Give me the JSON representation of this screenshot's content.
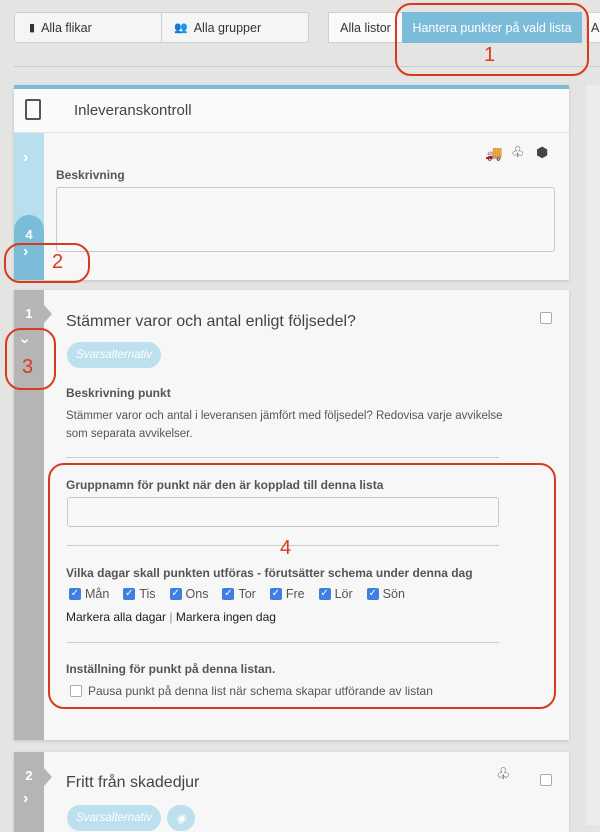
{
  "toolbar": {
    "all_tabs": "Alla flikar",
    "all_groups": "Alla grupper"
  },
  "tabs": [
    {
      "label": "Alla listor"
    },
    {
      "label": "Hantera punkter på vald lista",
      "active": true
    },
    {
      "label": "A"
    }
  ],
  "list_card": {
    "title": "Inleveranskontroll",
    "description_label": "Beskrivning",
    "description_value": "",
    "count": "4",
    "icons": [
      "truck-icon",
      "tree-icon",
      "cubes-icon"
    ]
  },
  "point1": {
    "number": "1",
    "title": "Stämmer varor och antal enligt följsedel?",
    "answer_btn": "Svarsalternativ",
    "desc_label": "Beskrivning punkt",
    "desc_text": "Stämmer varor och antal i leveransen jämfört med följsedel? Redovisa varje avvikelse som separata avvikelser.",
    "group_label": "Gruppnamn för punkt när den är kopplad till denna lista",
    "group_value": "",
    "days_label": "Vilka dagar skall punkten utföras - förutsätter schema under denna dag",
    "days": [
      {
        "label": "Mån",
        "checked": true
      },
      {
        "label": "Tis",
        "checked": true
      },
      {
        "label": "Ons",
        "checked": true
      },
      {
        "label": "Tor",
        "checked": true
      },
      {
        "label": "Fre",
        "checked": true
      },
      {
        "label": "Lör",
        "checked": true
      },
      {
        "label": "Sön",
        "checked": true
      }
    ],
    "mark_all": "Markera alla dagar",
    "sep": "|",
    "mark_none": "Markera ingen dag",
    "setting_label": "Inställning för punkt på denna listan.",
    "pause_label": "Pausa punkt på denna list när schema skapar utförande av listan",
    "pause_checked": false
  },
  "point2": {
    "number": "2",
    "title": "Fritt från skadedjur",
    "answer_btn": "Svarsalternativ"
  },
  "annotations": [
    "1",
    "2",
    "3",
    "4"
  ],
  "colors": {
    "accent": "#7bbcd9",
    "light_accent": "#b8dfee",
    "annotation": "#d93a1e",
    "checkbox": "#3f7fe0"
  }
}
